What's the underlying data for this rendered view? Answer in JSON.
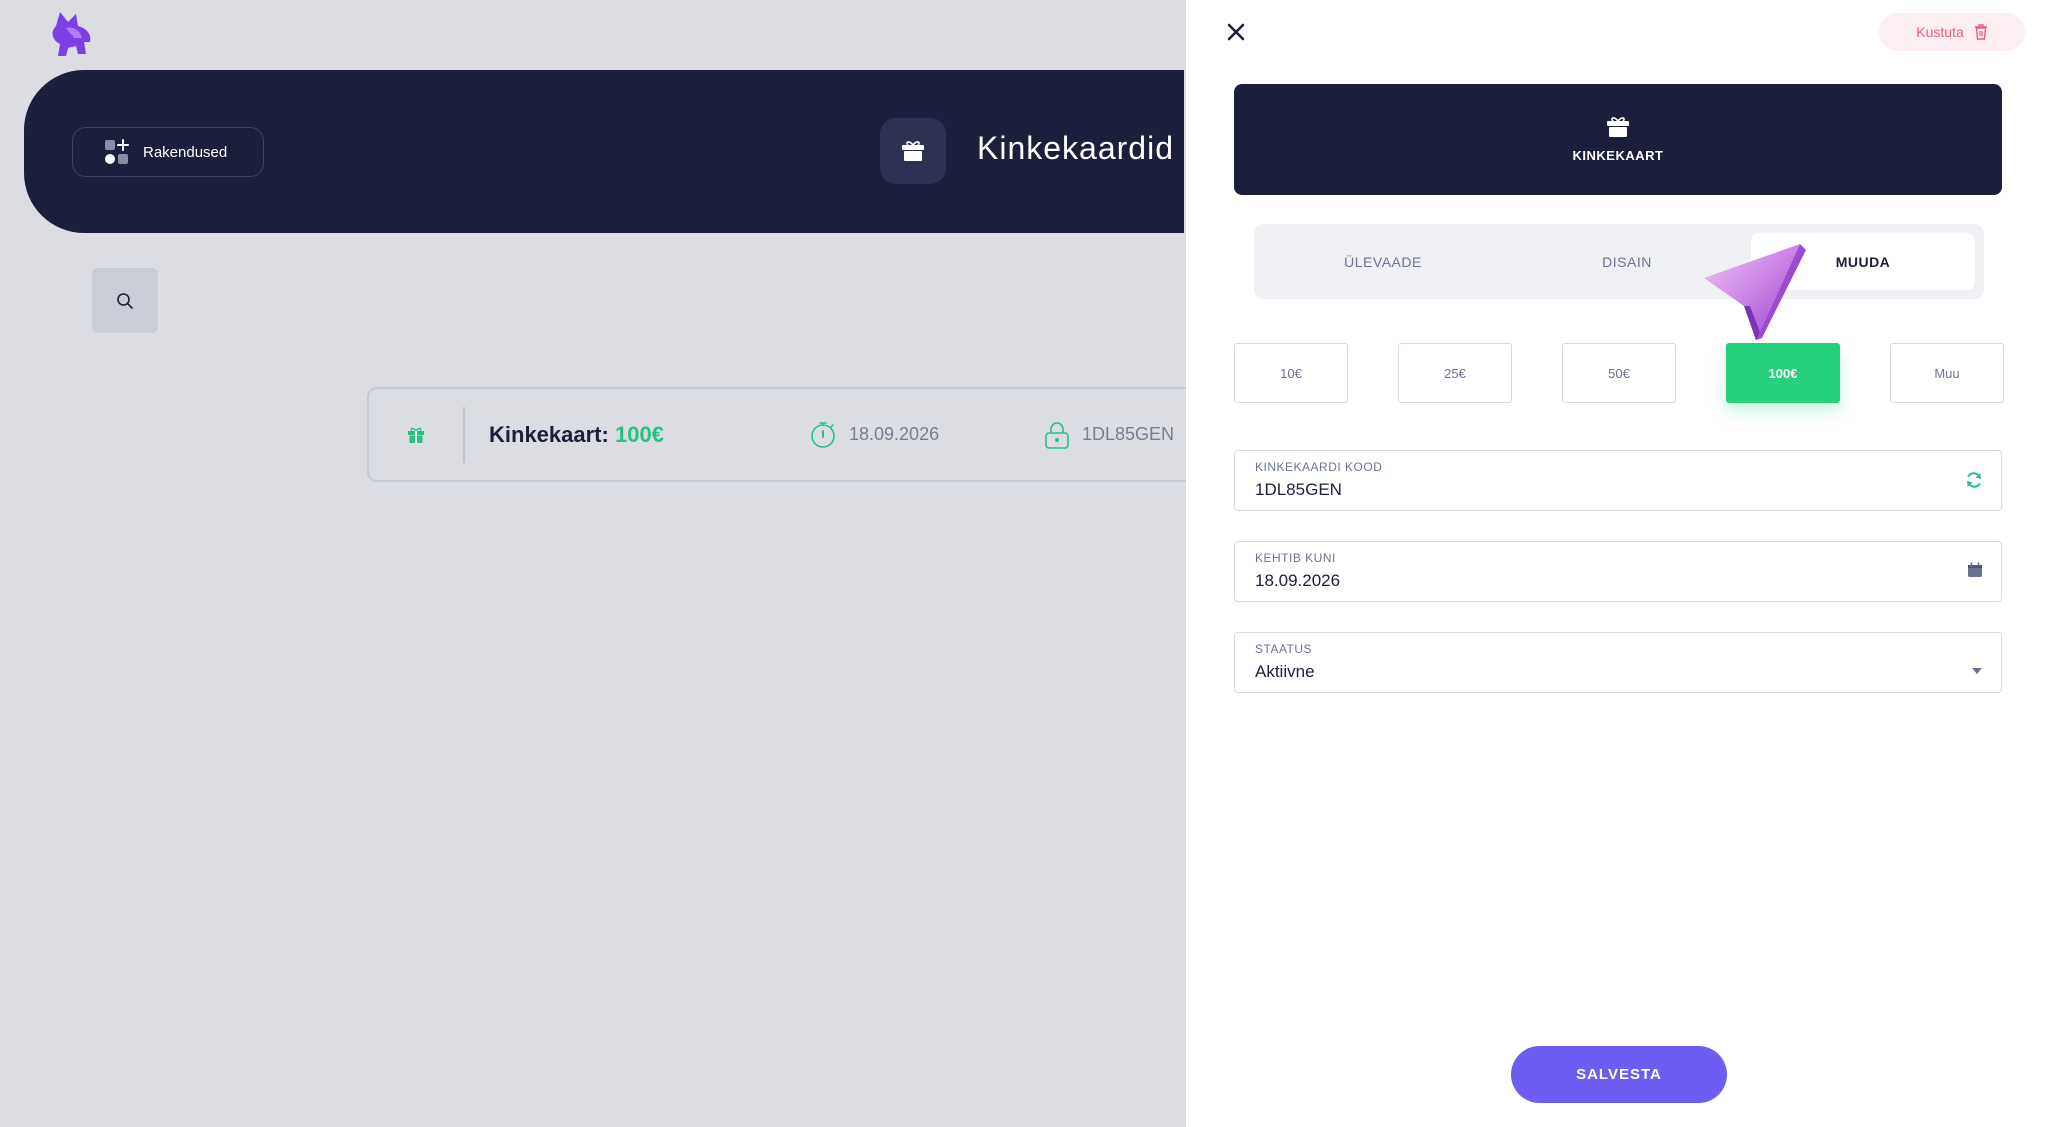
{
  "app": {
    "apps_button_label": "Rakendused",
    "page_title": "Kinkekaardid"
  },
  "gift_card_row": {
    "title_prefix": "Kinkekaart:",
    "amount": "100€",
    "valid_until": "18.09.2026",
    "code": "1DL85GEN"
  },
  "panel": {
    "delete_label": "Kustuta",
    "header_label": "KINKEKAART",
    "tabs": [
      {
        "label": "ÜLEVAADE",
        "active": false
      },
      {
        "label": "DISAIN",
        "active": false
      },
      {
        "label": "MUUDA",
        "active": true
      }
    ],
    "amount_options": [
      {
        "label": "10€",
        "selected": false
      },
      {
        "label": "25€",
        "selected": false
      },
      {
        "label": "50€",
        "selected": false
      },
      {
        "label": "100€",
        "selected": true
      },
      {
        "label": "Muu",
        "selected": false
      }
    ],
    "fields": {
      "code": {
        "label": "KINKEKAARDI KOOD",
        "value": "1DL85GEN"
      },
      "valid_until": {
        "label": "KEHTIB KUNI",
        "value": "18.09.2026"
      },
      "status": {
        "label": "STAATUS",
        "value": "Aktiivne"
      }
    },
    "save_label": "SALVESTA"
  },
  "colors": {
    "navy": "#1c1f3b",
    "green": "#26d07c",
    "purple": "#6d5df2",
    "delete_pink": "#ef5b7d"
  }
}
